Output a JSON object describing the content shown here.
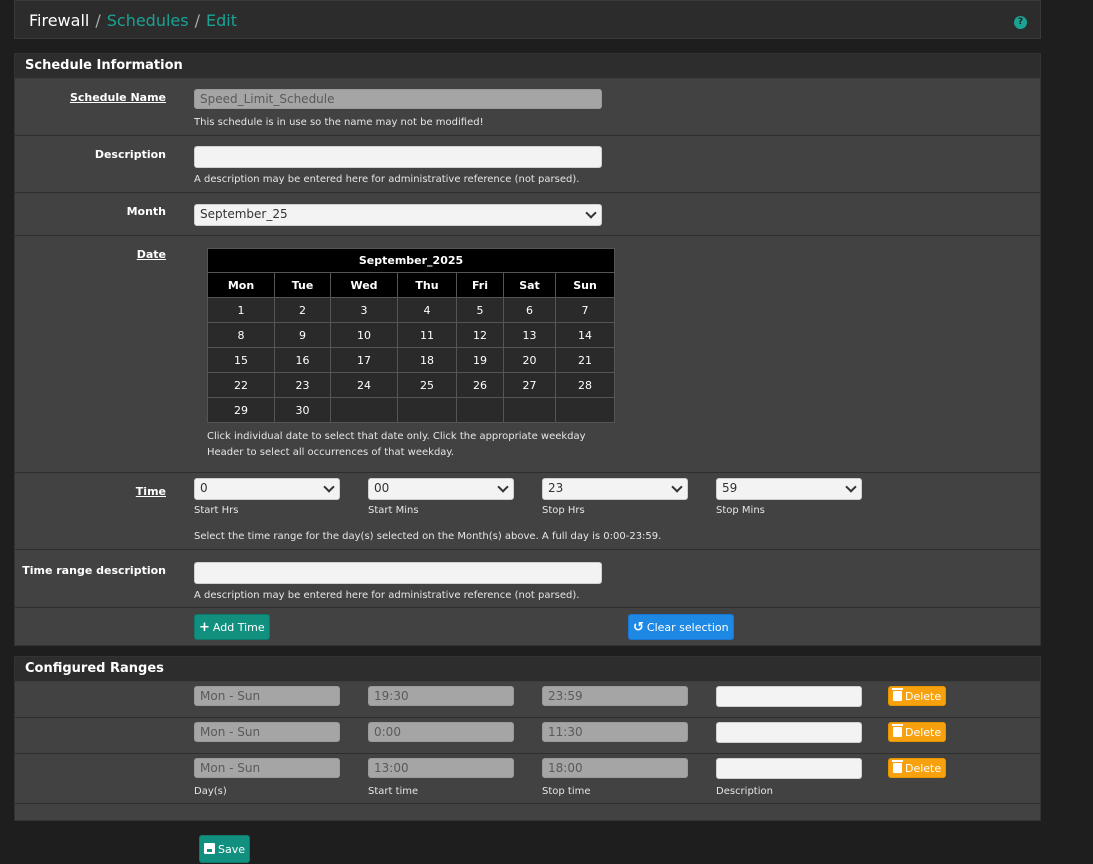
{
  "breadcrumb": {
    "root": "Firewall",
    "sep": "/",
    "schedules": "Schedules",
    "edit": "Edit"
  },
  "help_icon": "question-icon",
  "schedule_info": {
    "heading": "Schedule Information",
    "name_label": "Schedule Name",
    "name_value": "Speed_Limit_Schedule",
    "name_help": "This schedule is in use so the name may not be modified!",
    "desc_label": "Description",
    "desc_value": "",
    "desc_help": "A description may be entered here for administrative reference (not parsed).",
    "month_label": "Month",
    "month_value": "September_25",
    "date_label": "Date",
    "calendar": {
      "title": "September_2025",
      "weekdays": [
        "Mon",
        "Tue",
        "Wed",
        "Thu",
        "Fri",
        "Sat",
        "Sun"
      ],
      "weeks": [
        [
          "1",
          "2",
          "3",
          "4",
          "5",
          "6",
          "7"
        ],
        [
          "8",
          "9",
          "10",
          "11",
          "12",
          "13",
          "14"
        ],
        [
          "15",
          "16",
          "17",
          "18",
          "19",
          "20",
          "21"
        ],
        [
          "22",
          "23",
          "24",
          "25",
          "26",
          "27",
          "28"
        ],
        [
          "29",
          "30",
          "",
          "",
          "",
          "",
          ""
        ]
      ]
    },
    "date_help_1": "Click individual date to select that date only. Click the appropriate weekday",
    "date_help_2": "Header to select all occurrences of that weekday.",
    "time_label": "Time",
    "start_hrs": "0",
    "start_mins": "00",
    "stop_hrs": "23",
    "stop_mins": "59",
    "start_hrs_label": "Start Hrs",
    "start_mins_label": "Start Mins",
    "stop_hrs_label": "Stop Hrs",
    "stop_mins_label": "Stop Mins",
    "time_help": "Select the time range for the day(s) selected on the Month(s) above. A full day is 0:00-23:59.",
    "trd_label": "Time range description",
    "trd_value": "",
    "trd_help": "A description may be entered here for administrative reference (not parsed).",
    "add_time": "Add Time",
    "clear_selection": "Clear selection"
  },
  "configured_ranges": {
    "heading": "Configured Ranges",
    "rows": [
      {
        "days": "Mon - Sun",
        "start": "19:30",
        "stop": "23:59",
        "description": "",
        "delete": "Delete"
      },
      {
        "days": "Mon - Sun",
        "start": "0:00",
        "stop": "11:30",
        "description": "",
        "delete": "Delete"
      },
      {
        "days": "Mon - Sun",
        "start": "13:00",
        "stop": "18:00",
        "description": "",
        "delete": "Delete"
      }
    ],
    "col_days": "Day(s)",
    "col_start": "Start time",
    "col_stop": "Stop time",
    "col_desc": "Description"
  },
  "save": "Save",
  "colors": {
    "accent": "#1aa295",
    "button_teal": "#12907f",
    "button_blue": "#1e88e5",
    "button_orange": "#f8a10e"
  }
}
